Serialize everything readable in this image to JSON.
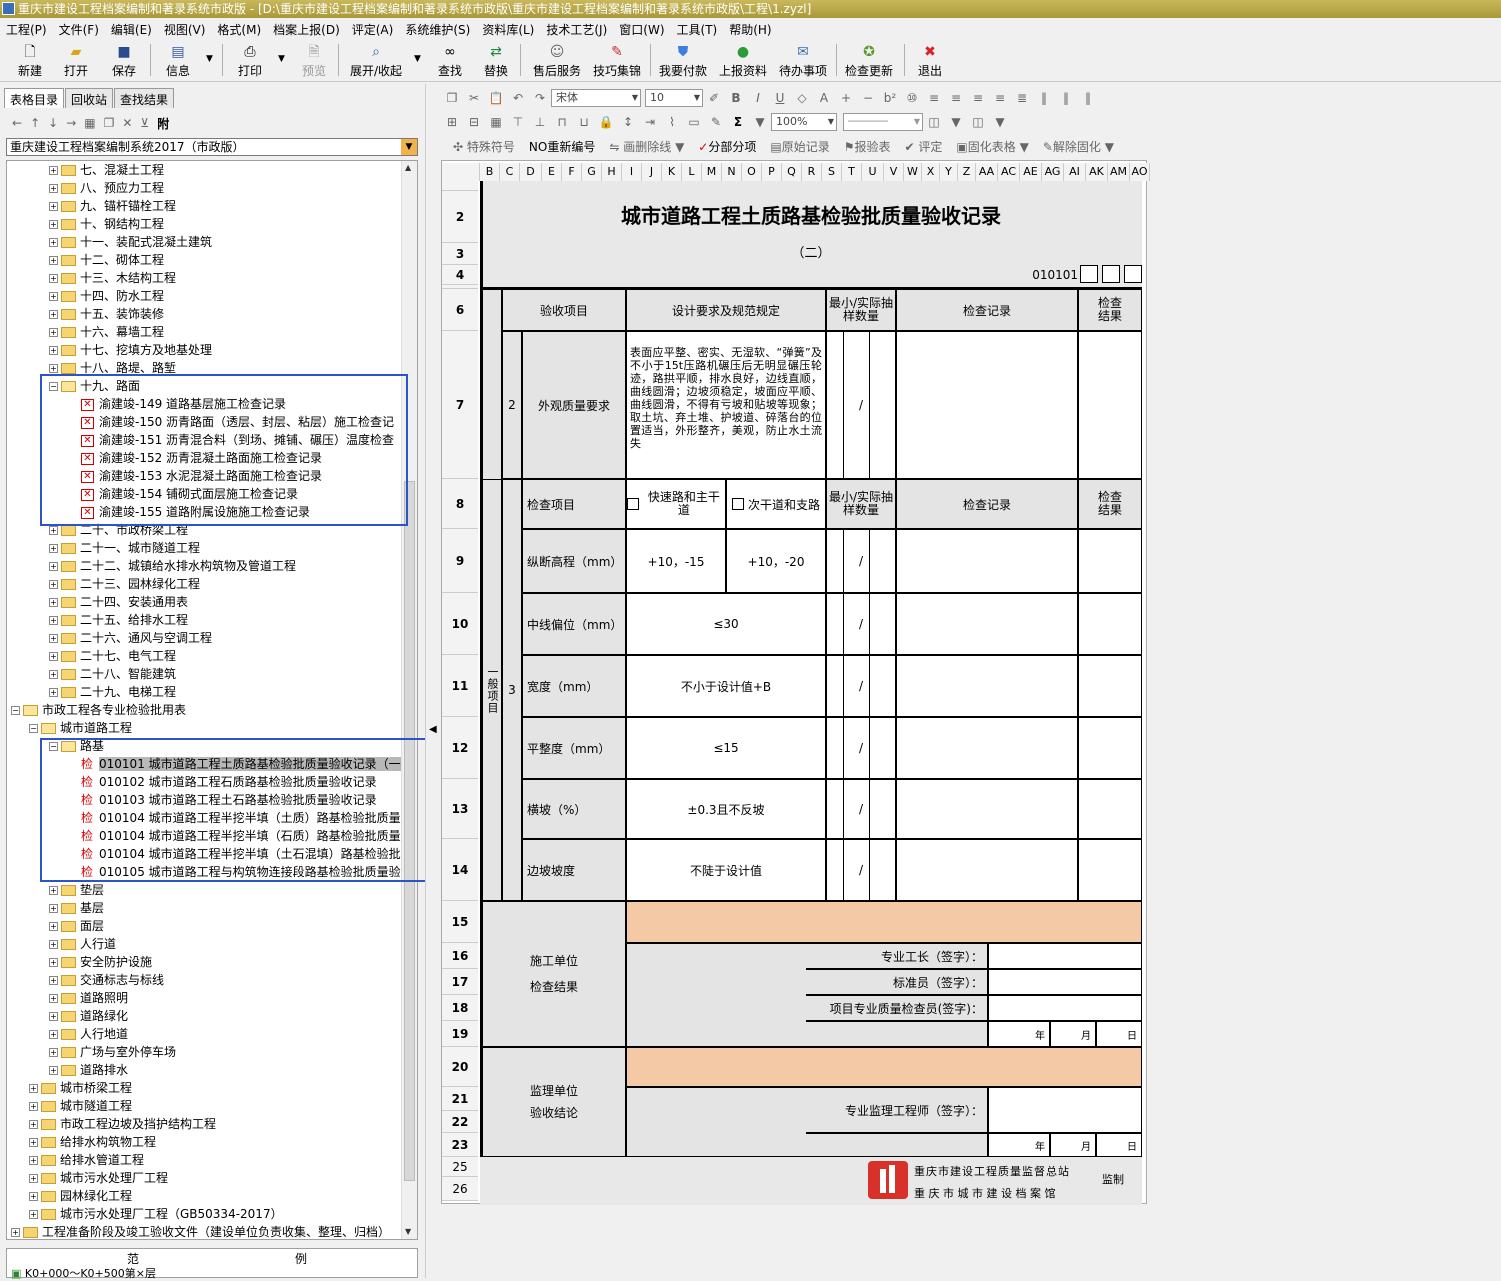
{
  "window": {
    "title": "重庆市建设工程档案编制和著录系统市政版 - [D:\\重庆市建设工程档案编制和著录系统市政版\\重庆市建设工程档案编制和著录系统市政版\\工程\\1.zyzl]"
  },
  "menu": [
    "工程(P)",
    "文件(F)",
    "编辑(E)",
    "视图(V)",
    "格式(M)",
    "档案上报(D)",
    "评定(A)",
    "系统维护(S)",
    "资料库(L)",
    "技术工艺(J)",
    "窗口(W)",
    "工具(T)",
    "帮助(H)"
  ],
  "toolbar": {
    "new": "新建",
    "open": "打开",
    "save": "保存",
    "info": "信息",
    "print": "打印",
    "preview": "预览",
    "expand": "展开/收起",
    "find": "查找",
    "replace": "替换",
    "service": "售后服务",
    "tips": "技巧集锦",
    "pay": "我要付款",
    "upload": "上报资料",
    "todo": "待办事项",
    "update": "检查更新",
    "exit": "退出"
  },
  "left_tabs": [
    "表格目录",
    "回收站",
    "查找结果"
  ],
  "left_tool_fu": "附",
  "combo": "重庆建设工程档案编制系统2017（市政版）",
  "tree": [
    {
      "d": 2,
      "t": "七、混凝土工程",
      "k": "f"
    },
    {
      "d": 2,
      "t": "八、预应力工程",
      "k": "f"
    },
    {
      "d": 2,
      "t": "九、锚杆锚栓工程",
      "k": "f"
    },
    {
      "d": 2,
      "t": "十、钢结构工程",
      "k": "f"
    },
    {
      "d": 2,
      "t": "十一、装配式混凝土建筑",
      "k": "f"
    },
    {
      "d": 2,
      "t": "十二、砌体工程",
      "k": "f"
    },
    {
      "d": 2,
      "t": "十三、木结构工程",
      "k": "f"
    },
    {
      "d": 2,
      "t": "十四、防水工程",
      "k": "f"
    },
    {
      "d": 2,
      "t": "十五、装饰装修",
      "k": "f"
    },
    {
      "d": 2,
      "t": "十六、幕墙工程",
      "k": "f"
    },
    {
      "d": 2,
      "t": "十七、挖填方及地基处理",
      "k": "f"
    },
    {
      "d": 2,
      "t": "十八、路堤、路堑",
      "k": "f"
    },
    {
      "d": 2,
      "t": "十九、路面",
      "k": "o"
    },
    {
      "d": 3,
      "t": "渝建竣-149  道路基层施工检查记录",
      "k": "x"
    },
    {
      "d": 3,
      "t": "渝建竣-150  沥青路面（透层、封层、粘层）施工检查记",
      "k": "x"
    },
    {
      "d": 3,
      "t": "渝建竣-151  沥青混合料（到场、摊铺、碾压）温度检查",
      "k": "x"
    },
    {
      "d": 3,
      "t": "渝建竣-152  沥青混凝土路面施工检查记录",
      "k": "x"
    },
    {
      "d": 3,
      "t": "渝建竣-153  水泥混凝土路面施工检查记录",
      "k": "x"
    },
    {
      "d": 3,
      "t": "渝建竣-154  铺砌式面层施工检查记录",
      "k": "x"
    },
    {
      "d": 3,
      "t": "渝建竣-155  道路附属设施施工检查记录",
      "k": "x"
    },
    {
      "d": 2,
      "t": "二十、市政桥梁工程",
      "k": "f"
    },
    {
      "d": 2,
      "t": "二十一、城市隧道工程",
      "k": "f"
    },
    {
      "d": 2,
      "t": "二十二、城镇给水排水构筑物及管道工程",
      "k": "f"
    },
    {
      "d": 2,
      "t": "二十三、园林绿化工程",
      "k": "f"
    },
    {
      "d": 2,
      "t": "二十四、安装通用表",
      "k": "f"
    },
    {
      "d": 2,
      "t": "二十五、给排水工程",
      "k": "f"
    },
    {
      "d": 2,
      "t": "二十六、通风与空调工程",
      "k": "f"
    },
    {
      "d": 2,
      "t": "二十七、电气工程",
      "k": "f"
    },
    {
      "d": 2,
      "t": "二十八、智能建筑",
      "k": "f"
    },
    {
      "d": 2,
      "t": "二十九、电梯工程",
      "k": "f"
    },
    {
      "d": 0,
      "t": "市政工程各专业检验批用表",
      "k": "o"
    },
    {
      "d": 1,
      "t": "城市道路工程",
      "k": "o"
    },
    {
      "d": 2,
      "t": "路基",
      "k": "o"
    },
    {
      "d": 3,
      "t": "010101  城市道路工程土质路基检验批质量验收记录（一",
      "k": "j",
      "sel": true
    },
    {
      "d": 3,
      "t": "010102  城市道路工程石质路基检验批质量验收记录",
      "k": "j"
    },
    {
      "d": 3,
      "t": "010103  城市道路工程土石路基检验批质量验收记录",
      "k": "j"
    },
    {
      "d": 3,
      "t": "010104  城市道路工程半挖半填（土质）路基检验批质量",
      "k": "j"
    },
    {
      "d": 3,
      "t": "010104  城市道路工程半挖半填（石质）路基检验批质量",
      "k": "j"
    },
    {
      "d": 3,
      "t": "010104  城市道路工程半挖半填（土石混填）路基检验批",
      "k": "j"
    },
    {
      "d": 3,
      "t": "010105  城市道路工程与构筑物连接段路基检验批质量验",
      "k": "j"
    },
    {
      "d": 2,
      "t": "垫层",
      "k": "f"
    },
    {
      "d": 2,
      "t": "基层",
      "k": "f"
    },
    {
      "d": 2,
      "t": "面层",
      "k": "f"
    },
    {
      "d": 2,
      "t": "人行道",
      "k": "f"
    },
    {
      "d": 2,
      "t": "安全防护设施",
      "k": "f"
    },
    {
      "d": 2,
      "t": "交通标志与标线",
      "k": "f"
    },
    {
      "d": 2,
      "t": "道路照明",
      "k": "f"
    },
    {
      "d": 2,
      "t": "道路绿化",
      "k": "f"
    },
    {
      "d": 2,
      "t": "人行地道",
      "k": "f"
    },
    {
      "d": 2,
      "t": "广场与室外停车场",
      "k": "f"
    },
    {
      "d": 2,
      "t": "道路排水",
      "k": "f"
    },
    {
      "d": 1,
      "t": "城市桥梁工程",
      "k": "f"
    },
    {
      "d": 1,
      "t": "城市隧道工程",
      "k": "f"
    },
    {
      "d": 1,
      "t": "市政工程边坡及挡护结构工程",
      "k": "f"
    },
    {
      "d": 1,
      "t": "给排水构筑物工程",
      "k": "f"
    },
    {
      "d": 1,
      "t": "给排水管道工程",
      "k": "f"
    },
    {
      "d": 1,
      "t": "城市污水处理厂工程",
      "k": "f"
    },
    {
      "d": 1,
      "t": "园林绿化工程",
      "k": "f"
    },
    {
      "d": 1,
      "t": "城市污水处理厂工程（GB50334-2017）",
      "k": "f"
    },
    {
      "d": 0,
      "t": "工程准备阶段及竣工验收文件（建设单位负责收集、整理、归档）",
      "k": "f"
    }
  ],
  "legend": {
    "h1": "范",
    "h2": "例",
    "item": "K0+000～K0+500第×层"
  },
  "fmt": {
    "font": "宋体",
    "size": "10",
    "zoom": "100%"
  },
  "rtool3": [
    "特殊符号",
    "NO重新编号",
    "画删除线",
    "分部分项",
    "原始记录",
    "报验表",
    "评定",
    "固化表格",
    "解除固化"
  ],
  "columns": [
    "B",
    "C",
    "D",
    "E",
    "F",
    "G",
    "H",
    "I",
    "J",
    "K",
    "L",
    "M",
    "N",
    "O",
    "P",
    "Q",
    "R",
    "S",
    "T",
    "U",
    "V",
    "W",
    "X",
    "Y",
    "Z",
    "AA",
    "AC",
    "AE",
    "AG",
    "AI",
    "AK",
    "AM",
    "AO"
  ],
  "form": {
    "title": "城市道路工程土质路基检验批质量验收记录",
    "subtitle": "（二）",
    "code": "010101",
    "h_item": "验收项目",
    "h_req": "设计要求及规范规定",
    "h_sample": "最小/实际抽样数量",
    "h_record": "检查记录",
    "h_result": "检查结果",
    "r7_no": "2",
    "r7_item": "外观质量要求",
    "r7_req": "表面应平整、密实、无湿软、“弹簧”及不小于15t压路机碾压后无明显碾压轮迹，路拱平顺，排水良好，边线直顺，曲线圆滑；边坡须稳定，坡面应平顺、曲线圆滑，不得有亏坡和贴坡等现象；取土坑、弃土堆、护坡道、碎落台的位置适当，外形整齐，美观，防止水土流失",
    "slash": "/",
    "r8_item": "检查项目",
    "r8_opt1": "快速路和主干道",
    "r8_opt2": "次干道和支路",
    "general": "一般项目",
    "r_no3": "3",
    "rows": [
      {
        "item": "纵断高程（mm）",
        "v1": "+10，-15",
        "v2": "+10，-20"
      },
      {
        "item": "中线偏位（mm）",
        "v": "≤30"
      },
      {
        "item": "宽度（mm）",
        "v": "不小于设计值+B"
      },
      {
        "item": "平整度（mm）",
        "v": "≤15"
      },
      {
        "item": "横坡（%）",
        "v": "±0.3且不反坡"
      },
      {
        "item": "边坡坡度",
        "v": "不陡于设计值"
      }
    ],
    "construct_unit": "施工单位\n检查结果",
    "foreman": "专业工长（签字）：",
    "standard": "标准员（签字）：",
    "inspector": "项目专业质量检查员(签字)：",
    "year": "年",
    "month": "月",
    "day": "日",
    "supervise_unit": "监理单位\n验收结论",
    "engineer": "专业监理工程师（签字）：",
    "stamp1": "重庆市建设工程质量监督总站",
    "stamp2": "重 庆 市 城 市 建 设 档 案 馆",
    "stamp3": "监制"
  },
  "colors": {
    "title_bar": "#b3a443",
    "highlight_box": "#2a54c8",
    "peach": "#f3caa5",
    "gray": "#e4e4e4"
  }
}
